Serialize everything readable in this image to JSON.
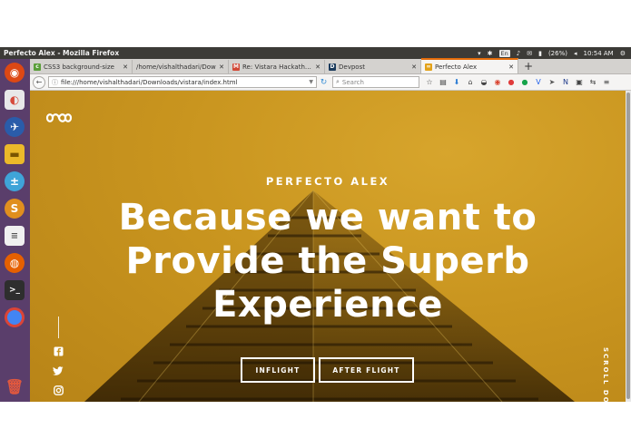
{
  "os": {
    "window_title": "Perfecto Alex - Mozilla Firefox",
    "keyboard_layout": "En",
    "battery": "(26%)",
    "time": "10:54 AM"
  },
  "browser": {
    "tabs": [
      {
        "label": "CSS3 background-size",
        "favicon": "css3-favicon",
        "favicon_color": "#5a9e3a"
      },
      {
        "label": "/home/vishalthadari/Dow",
        "favicon": "",
        "favicon_color": ""
      },
      {
        "label": "Re: Vistara Hackathon",
        "favicon": "gmail-favicon",
        "favicon_color": "#d14836"
      },
      {
        "label": "Devpost",
        "favicon": "devpost-favicon",
        "favicon_color": "#1a3a5c"
      },
      {
        "label": "Perfecto Alex",
        "favicon": "site-favicon",
        "favicon_color": "#e3a21a",
        "active": true
      }
    ],
    "url": "file:///home/vishalthadari/Downloads/vistara/index.html",
    "search_placeholder": "Search"
  },
  "page": {
    "kicker": "PERFECTO ALEX",
    "headline_line1": "Because we want to",
    "headline_line2": "Provide the Superb",
    "headline_line3": "Experience",
    "button_inflight": "INFLIGHT",
    "button_after_flight": "AFTER FLIGHT",
    "scroll_label": "SCROLL DO",
    "accent_color": "#c9951f"
  }
}
